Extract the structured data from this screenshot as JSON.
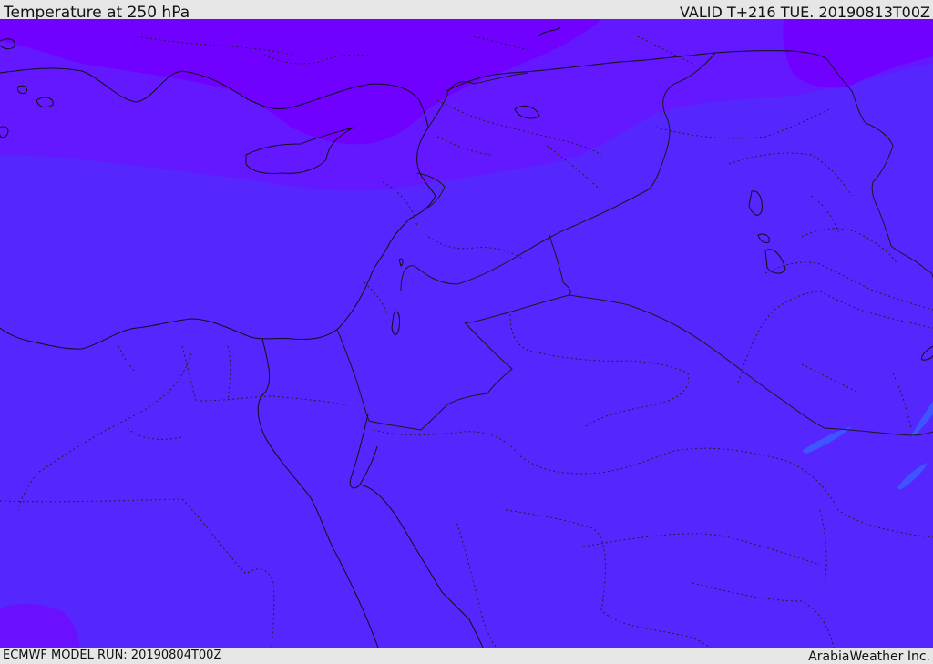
{
  "header": {
    "title": "Temperature at 250 hPa",
    "valid_time": "VALID T+216 TUE. 20190813T00Z"
  },
  "footer": {
    "model_run": "ECMWF MODEL RUN: 20190804T00Z",
    "brand": "ArabiaWeather Inc."
  },
  "colors": {
    "main_field": "#5626ff",
    "cold_band": "#7000ff",
    "mid_band": "#6418ff",
    "warm_spot": "#3e56ff",
    "coastline": "#111111",
    "border": "#1a1a1a"
  },
  "icons": {
    "map": "weather-map"
  }
}
